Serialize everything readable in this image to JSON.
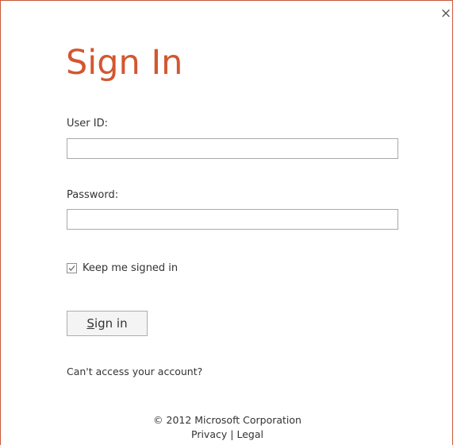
{
  "dialog": {
    "close_glyph": "×",
    "title": "Sign In"
  },
  "form": {
    "userid_label": "User ID:",
    "userid_value": "",
    "password_label": "Password:",
    "password_value": "",
    "keep_signed_in_label": "Keep me signed in",
    "keep_signed_in_checked": true,
    "signin_button_label": "Sign in",
    "signin_button_mnemonic": "S",
    "signin_button_rest": "ign in"
  },
  "help": {
    "cant_access_label": "Can't access your account?"
  },
  "footer": {
    "copyright": "© 2012 Microsoft Corporation",
    "privacy_label": "Privacy",
    "separator": "|",
    "legal_label": "Legal"
  },
  "colors": {
    "accent": "#d2572f",
    "border": "#c8573a"
  },
  "icons": {
    "close": "close-icon",
    "check": "checkmark-icon"
  }
}
